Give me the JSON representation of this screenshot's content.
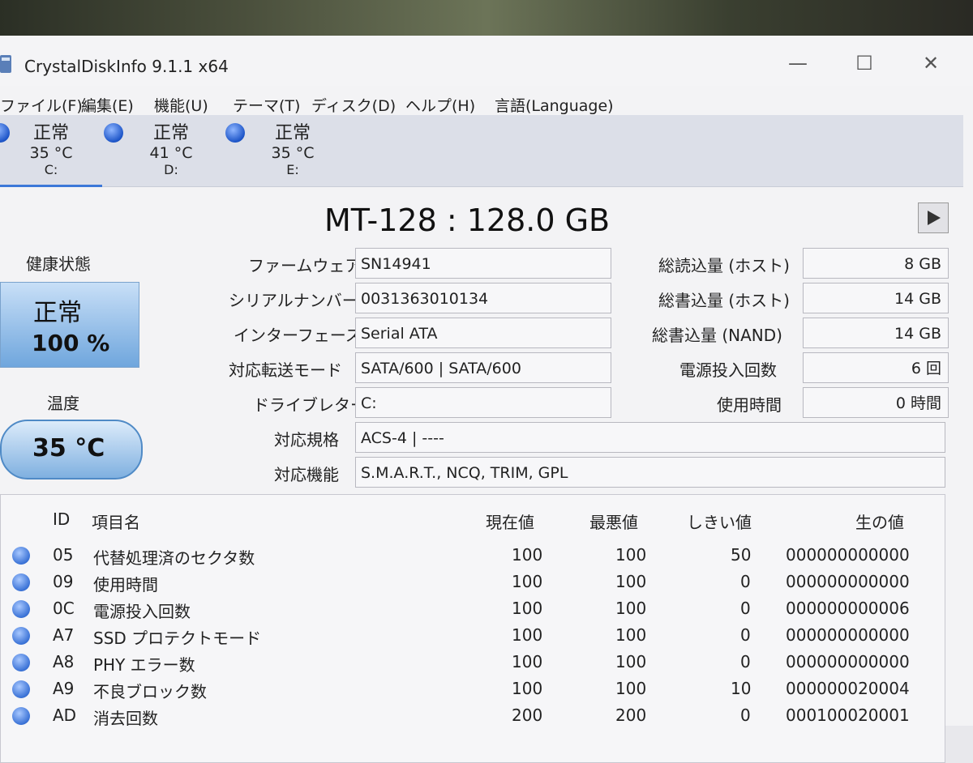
{
  "app": {
    "title": "CrystalDiskInfo 9.1.1 x64",
    "min_icon": "minimize-icon",
    "max_icon": "maximize-icon",
    "close_icon": "close-icon"
  },
  "menu": [
    "ファイル(F)",
    "編集(E)",
    "機能(U)",
    "テーマ(T)",
    "ディスク(D)",
    "ヘルプ(H)",
    "言語(Language)"
  ],
  "disks": [
    {
      "status": "正常",
      "temp": "35 °C",
      "letter": "C:"
    },
    {
      "status": "正常",
      "temp": "41 °C",
      "letter": "D:"
    },
    {
      "status": "正常",
      "temp": "35 °C",
      "letter": "E:"
    }
  ],
  "model": "MT-128 : 128.0 GB",
  "health": {
    "label": "健康状態",
    "status": "正常",
    "percent": "100 %"
  },
  "temperature": {
    "label": "温度",
    "value": "35 °C"
  },
  "info_left": [
    {
      "label": "ファームウェア",
      "value": "SN14941"
    },
    {
      "label": "シリアルナンバー",
      "value": "0031363010134"
    },
    {
      "label": "インターフェース",
      "value": "Serial ATA"
    },
    {
      "label": "対応転送モード",
      "value": "SATA/600 | SATA/600"
    },
    {
      "label": "ドライブレター",
      "value": "C:"
    }
  ],
  "info_right": [
    {
      "label": "総読込量 (ホスト)",
      "value": "8 GB"
    },
    {
      "label": "総書込量 (ホスト)",
      "value": "14 GB"
    },
    {
      "label": "総書込量 (NAND)",
      "value": "14 GB"
    },
    {
      "label": "電源投入回数",
      "value": "6 回"
    },
    {
      "label": "使用時間",
      "value": "0 時間"
    }
  ],
  "standard": {
    "label": "対応規格",
    "value": "ACS-4 | ----"
  },
  "features": {
    "label": "対応機能",
    "value": "S.M.A.R.T., NCQ, TRIM, GPL"
  },
  "smart": {
    "headers": [
      "ID",
      "項目名",
      "現在値",
      "最悪値",
      "しきい値",
      "生の値"
    ],
    "rows": [
      {
        "id": "05",
        "name": "代替処理済のセクタ数",
        "cur": "100",
        "worst": "100",
        "thr": "50",
        "raw": "000000000000"
      },
      {
        "id": "09",
        "name": "使用時間",
        "cur": "100",
        "worst": "100",
        "thr": "0",
        "raw": "000000000000"
      },
      {
        "id": "0C",
        "name": "電源投入回数",
        "cur": "100",
        "worst": "100",
        "thr": "0",
        "raw": "000000000006"
      },
      {
        "id": "A7",
        "name": "SSD プロテクトモード",
        "cur": "100",
        "worst": "100",
        "thr": "0",
        "raw": "000000000000"
      },
      {
        "id": "A8",
        "name": "PHY エラー数",
        "cur": "100",
        "worst": "100",
        "thr": "0",
        "raw": "000000000000"
      },
      {
        "id": "A9",
        "name": "不良ブロック数",
        "cur": "100",
        "worst": "100",
        "thr": "10",
        "raw": "000000020004"
      },
      {
        "id": "AD",
        "name": "消去回数",
        "cur": "200",
        "worst": "200",
        "thr": "0",
        "raw": "000100020001"
      }
    ]
  }
}
